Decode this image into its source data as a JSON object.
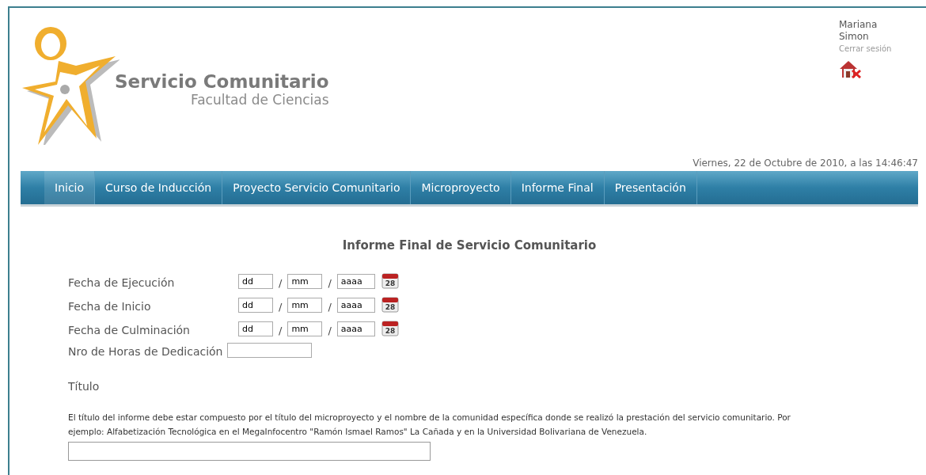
{
  "header": {
    "logo": {
      "title": "Servicio Comunitario",
      "subtitle": "Facultad de Ciencias"
    },
    "user": {
      "first_name": "Mariana",
      "last_name": "Simon",
      "logout": "Cerrar sesión"
    }
  },
  "datetime": "Viernes, 22 de Octubre de 2010, a las 14:46:47",
  "nav": [
    {
      "label": "Inicio",
      "selected": true
    },
    {
      "label": "Curso de Inducción",
      "selected": false
    },
    {
      "label": "Proyecto Servicio Comunitario",
      "selected": false
    },
    {
      "label": "Microproyecto",
      "selected": false
    },
    {
      "label": "Informe Final",
      "selected": false
    },
    {
      "label": "Presentación",
      "selected": false
    }
  ],
  "form": {
    "title": "Informe Final de Servicio Comunitario",
    "fields": [
      {
        "kind": "date",
        "label": "Fecha de Ejecución",
        "parts": [
          "dd",
          "mm",
          "aaaa"
        ],
        "separator": "/",
        "calendar": "28"
      },
      {
        "kind": "date",
        "label": "Fecha de Inicio",
        "parts": [
          "dd",
          "mm",
          "aaaa"
        ],
        "separator": "/",
        "calendar": "28"
      },
      {
        "kind": "date",
        "label": "Fecha de Culminación",
        "parts": [
          "dd",
          "mm",
          "aaaa"
        ],
        "separator": "/",
        "calendar": "28"
      },
      {
        "kind": "text",
        "label": "Nro de Horas de Dedicación"
      }
    ],
    "title_field": {
      "label": "Título",
      "help": "El título del informe debe estar compuesto por el título del microproyecto y el nombre de la comunidad específica donde se realizó la prestación del servicio comunitario. Por ejemplo: Alfabetización Tecnológica en el MegaInfocentro \"Ramón Ismael Ramos\" La Cañada y en la Universidad Bolivariana de Venezuela."
    }
  }
}
